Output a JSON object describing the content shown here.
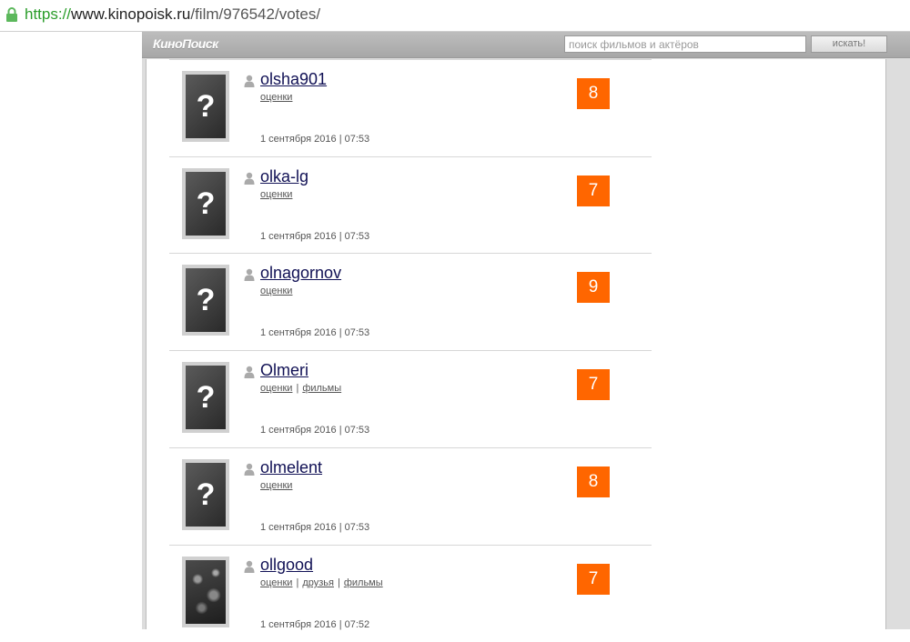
{
  "browser": {
    "url_scheme": "https://",
    "url_host": "www.kinopoisk.ru",
    "url_path": "/film/976542/votes/"
  },
  "header": {
    "logo": "КиноПоиск",
    "search_placeholder": "поиск фильмов и актёров",
    "search_button": "искать!"
  },
  "separator": "|",
  "votes": [
    {
      "username": "olsha901",
      "links": [
        "оценки"
      ],
      "date": "1 сентября 2016 | 07:53",
      "rating": "8",
      "avatar": "placeholder"
    },
    {
      "username": "olka-lg",
      "links": [
        "оценки"
      ],
      "date": "1 сентября 2016 | 07:53",
      "rating": "7",
      "avatar": "placeholder"
    },
    {
      "username": "olnagornov",
      "links": [
        "оценки"
      ],
      "date": "1 сентября 2016 | 07:53",
      "rating": "9",
      "avatar": "placeholder"
    },
    {
      "username": "Olmeri",
      "links": [
        "оценки",
        "фильмы"
      ],
      "date": "1 сентября 2016 | 07:53",
      "rating": "7",
      "avatar": "placeholder"
    },
    {
      "username": "olmelent",
      "links": [
        "оценки"
      ],
      "date": "1 сентября 2016 | 07:53",
      "rating": "8",
      "avatar": "placeholder"
    },
    {
      "username": "ollgood",
      "links": [
        "оценки",
        "друзья",
        "фильмы"
      ],
      "date": "1 сентября 2016 | 07:52",
      "rating": "7",
      "avatar": "photo"
    }
  ],
  "colors": {
    "rating_bg": "#ff6600",
    "username": "#111155",
    "accent_lock": "#5cb85c"
  }
}
